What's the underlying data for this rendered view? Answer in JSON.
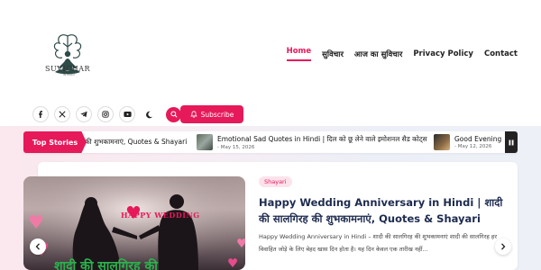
{
  "site": {
    "logo_text": "SUVICHAR",
    "logo_subtext": "IN HINDI"
  },
  "nav": {
    "items": [
      {
        "label": "Home",
        "active": true
      },
      {
        "label": "सुविचार",
        "active": false
      },
      {
        "label": "आज का सुविचार",
        "active": false
      },
      {
        "label": "Privacy Policy",
        "active": false
      },
      {
        "label": "Contact",
        "active": false
      }
    ]
  },
  "social": {
    "icons": [
      "facebook-icon",
      "x-icon",
      "telegram-icon",
      "instagram-icon",
      "youtube-icon",
      "dark-mode-icon",
      "search-icon"
    ]
  },
  "subscribe": {
    "label": "Subscribe"
  },
  "ticker": {
    "label": "Top Stories",
    "items": [
      {
        "title": "की शुभकामनाएं, Quotes & Shayari",
        "date": ""
      },
      {
        "title": "Emotional Sad Quotes in Hindi | दिल को छू लेने वाले इमोशनल सैड कोट्स",
        "date": "- May 15, 2026"
      },
      {
        "title": "Good Evening",
        "date": "- May 12, 2026"
      }
    ]
  },
  "featured": {
    "category": "Shayari",
    "title": "Happy Wedding Anniversary in Hindi | शादी की सालगिरह की शुभकामनाएं, Quotes & Shayari",
    "excerpt": "Happy Wedding Anniversary in Hindi – शादी की सालगिरह की शुभकामनाएं शादी की सालगिरह हर विवाहित जोड़े के लिए बेहद खास दिन होता है। यह दिन केवल एक तारीख नहीं...",
    "image_text": "HAPPY WEDDING",
    "image_caption": "शादी की सालगिरह की"
  },
  "colors": {
    "accent": "#e6195a",
    "headline": "#1d2b4f"
  }
}
